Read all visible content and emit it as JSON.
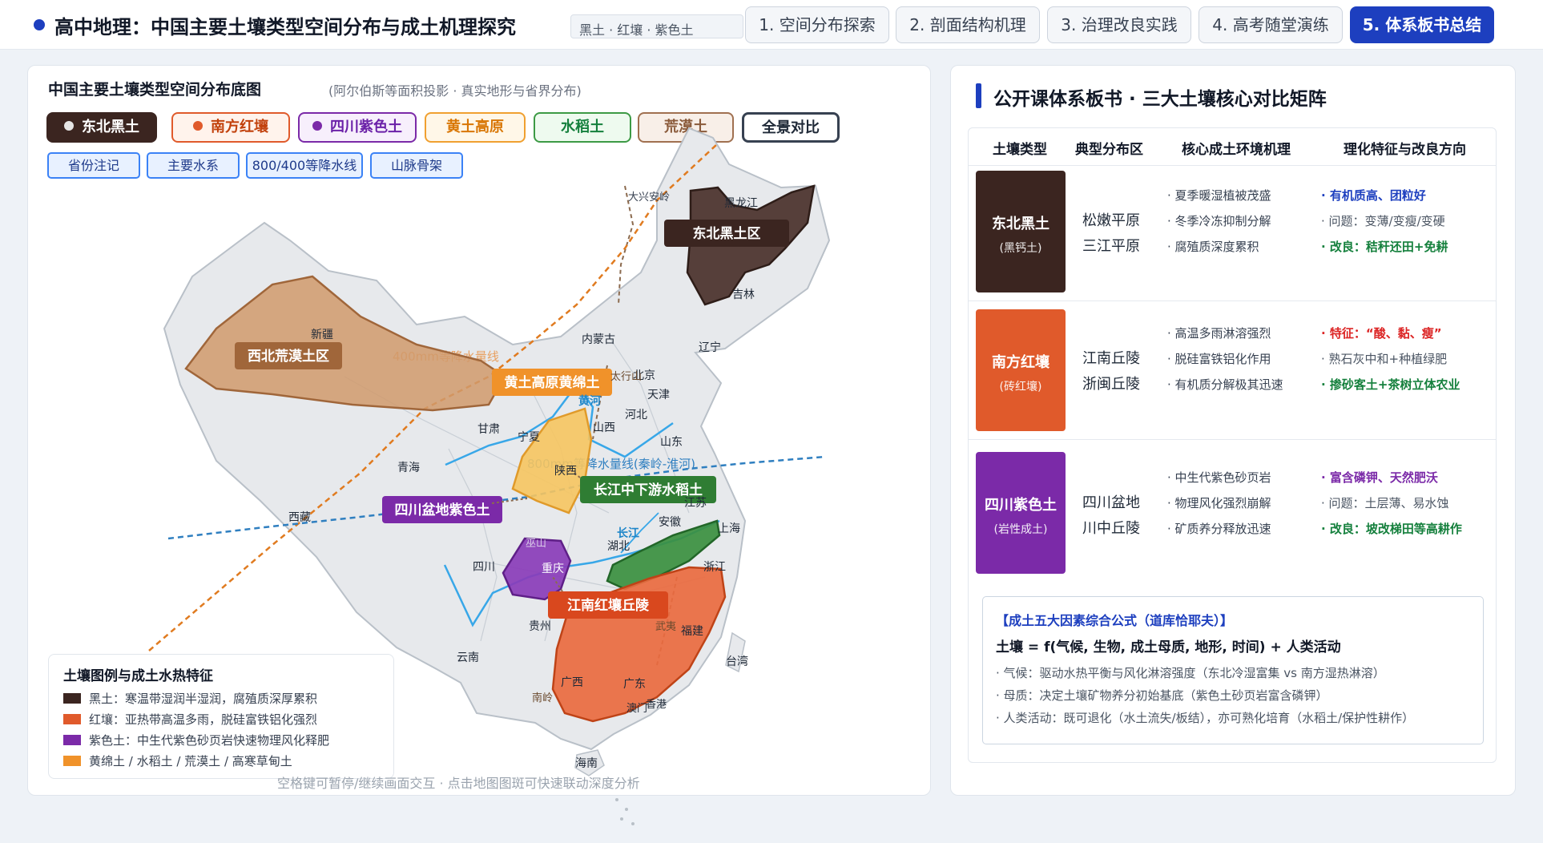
{
  "header": {
    "title": "高中地理：中国主要土壤类型空间分布与成土机理探究",
    "search_chip": "黑土 · 红壤 · 紫色土",
    "tabs": [
      {
        "label": "1. 空间分布探索"
      },
      {
        "label": "2. 剖面结构机理"
      },
      {
        "label": "3. 治理改良实践"
      },
      {
        "label": "4. 高考随堂演练"
      },
      {
        "label": "5. 体系板书总结"
      }
    ]
  },
  "map": {
    "title": "中国主要土壤类型空间分布底图",
    "subtitle": "(阿尔伯斯等面积投影 · 真实地形与省界分布)",
    "soil_buttons": [
      {
        "label": "东北黑土",
        "color": "#3b2520"
      },
      {
        "label": "南方红壤",
        "color": "#e05a2b"
      },
      {
        "label": "四川紫色土",
        "color": "#7b2aa8"
      },
      {
        "label": "黄土高原",
        "color": "#f0a030"
      },
      {
        "label": "水稻土",
        "color": "#3d9a45"
      },
      {
        "label": "荒漠土",
        "color": "#a07050"
      },
      {
        "label": "全景对比",
        "color": "#374151"
      }
    ],
    "layer_chips": [
      "省份注记",
      "主要水系",
      "800/400等降水线",
      "山脉骨架"
    ],
    "zone_labels": {
      "heitu": "东北黑土区",
      "desert": "西北荒漠土区",
      "loess": "黄土高原黄绵土",
      "purple": "四川盆地紫色土",
      "paddy": "长江中下游水稻土",
      "red": "江南红壤丘陵"
    },
    "line_labels": {
      "isohyet400": "400mm等降水量线",
      "isohyet800": "800mm等降水量线(秦岭-淮河)"
    },
    "provinces": [
      "大兴安岭",
      "黑龙江",
      "吉林",
      "辽宁",
      "内蒙古",
      "新疆",
      "北京",
      "天津",
      "河北",
      "山西",
      "甘肃",
      "宁夏",
      "陕西",
      "山东",
      "青海",
      "西藏",
      "江苏",
      "安徽",
      "上海",
      "湖北",
      "浙江",
      "四川",
      "重庆",
      "巫山",
      "福建",
      "贵州",
      "云南",
      "广西",
      "广东",
      "澳门",
      "香港",
      "台湾",
      "海南",
      "南岭",
      "武夷",
      "太行山"
    ],
    "rivers": {
      "huanghe": "黄河",
      "changjiang": "长江"
    },
    "legend": {
      "title": "土壤图例与成土水热特征",
      "items": [
        {
          "text": "黑土：寒温带湿润半湿润，腐殖质深厚累积",
          "color": "#3b2520"
        },
        {
          "text": "红壤：亚热带高温多雨，脱硅富铁铝化强烈",
          "color": "#e05a2b"
        },
        {
          "text": "紫色土：中生代紫色砂页岩快速物理风化释肥",
          "color": "#7b2aa8"
        },
        {
          "text": "黄绵土 / 水稻土 / 荒漠土 / 高寒草甸土",
          "color": "#f0922a"
        }
      ]
    },
    "hint": "空格键可暂停/继续画面交互 · 点击地图图斑可快速联动深度分析"
  },
  "board": {
    "title": "公开课体系板书 · 三大土壤核心对比矩阵",
    "headers": [
      "土壤类型",
      "典型分布区",
      "核心成土环境机理",
      "理化特征与改良方向"
    ],
    "rows": [
      {
        "name": "东北黑土",
        "sub": "(黑钙土)",
        "color": "#3b2520",
        "regions": [
          "松嫩平原",
          "三江平原"
        ],
        "mechanisms": [
          "· 夏季暖湿植被茂盛",
          "· 冬季冷冻抑制分解",
          "· 腐殖质深度累积"
        ],
        "features": [
          {
            "text": "· 有机质高、团粒好",
            "color": "#1d3fbf",
            "bold": true
          },
          {
            "text": "· 问题：变薄/变瘦/变硬",
            "color": "#4b5563",
            "bold": false
          },
          {
            "text": "· 改良：秸秆还田+免耕",
            "color": "#15803d",
            "bold": true
          }
        ]
      },
      {
        "name": "南方红壤",
        "sub": "(砖红壤)",
        "color": "#e05a2b",
        "regions": [
          "江南丘陵",
          "浙闽丘陵"
        ],
        "mechanisms": [
          "· 高温多雨淋溶强烈",
          "· 脱硅富铁铝化作用",
          "· 有机质分解极其迅速"
        ],
        "features": [
          {
            "text": "· 特征：“酸、黏、瘦”",
            "color": "#dc2626",
            "bold": true
          },
          {
            "text": "· 熟石灰中和+种植绿肥",
            "color": "#4b5563",
            "bold": false
          },
          {
            "text": "· 掺砂客土+茶树立体农业",
            "color": "#15803d",
            "bold": true
          }
        ]
      },
      {
        "name": "四川紫色土",
        "sub": "(岩性成土)",
        "color": "#7b2aa8",
        "regions": [
          "四川盆地",
          "川中丘陵"
        ],
        "mechanisms": [
          "· 中生代紫色砂页岩",
          "· 物理风化强烈崩解",
          "· 矿质养分释放迅速"
        ],
        "features": [
          {
            "text": "· 富含磷钾、天然肥沃",
            "color": "#7b2aa8",
            "bold": true
          },
          {
            "text": "· 问题：土层薄、易水蚀",
            "color": "#4b5563",
            "bold": false
          },
          {
            "text": "· 改良：坡改梯田等高耕作",
            "color": "#15803d",
            "bold": true
          }
        ]
      }
    ],
    "formula": {
      "title": "【成土五大因素综合公式（道库恰耶夫）】",
      "main": "土壤 = f(气候, 生物, 成土母质, 地形, 时间) + 人类活动",
      "lines": [
        "· 气候：驱动水热平衡与风化淋溶强度（东北冷湿富集 vs 南方湿热淋溶）",
        "· 母质：决定土壤矿物养分初始基底（紫色土砂页岩富含磷钾）",
        "· 人类活动：既可退化（水土流失/板结），亦可熟化培育（水稻土/保护性耕作）"
      ]
    }
  }
}
